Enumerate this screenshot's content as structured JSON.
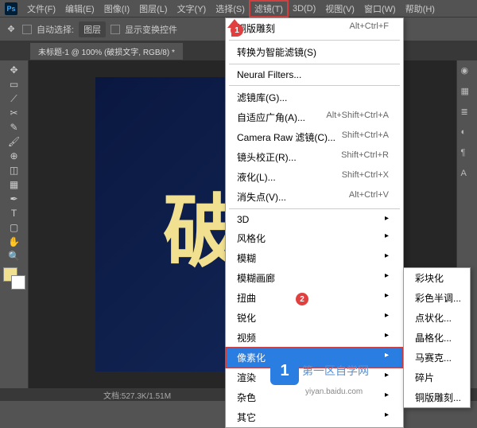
{
  "menubar": {
    "items": [
      "文件(F)",
      "编辑(E)",
      "图像(I)",
      "图层(L)",
      "文字(Y)",
      "选择(S)",
      "滤镜(T)",
      "3D(D)",
      "视图(V)",
      "窗口(W)",
      "帮助(H)"
    ],
    "active_index": 6
  },
  "optionsbar": {
    "auto_select": "自动选择:",
    "layer_select": "图层",
    "show_transform": "显示变换控件"
  },
  "doctab": {
    "title": "未标题-1 @ 100% (破损文字, RGB/8) *"
  },
  "canvas": {
    "text": "破损",
    "bg_color1": "#0a1840",
    "bg_color2": "#14285a",
    "text_color": "#f0e090"
  },
  "statusbar": {
    "text": "文档:527.3K/1.51M"
  },
  "dropdown_main": {
    "top": [
      {
        "label": "铜版雕刻",
        "shortcut": "Alt+Ctrl+F"
      }
    ],
    "smart": {
      "label": "转换为智能滤镜(S)"
    },
    "neural": {
      "label": "Neural Filters..."
    },
    "group1": [
      {
        "label": "滤镜库(G)...",
        "shortcut": ""
      },
      {
        "label": "自适应广角(A)...",
        "shortcut": "Alt+Shift+Ctrl+A"
      },
      {
        "label": "Camera Raw 滤镜(C)...",
        "shortcut": "Shift+Ctrl+A"
      },
      {
        "label": "镜头校正(R)...",
        "shortcut": "Shift+Ctrl+R"
      },
      {
        "label": "液化(L)...",
        "shortcut": "Shift+Ctrl+X"
      },
      {
        "label": "消失点(V)...",
        "shortcut": "Alt+Ctrl+V"
      }
    ],
    "group2": [
      {
        "label": "3D",
        "sub": true
      },
      {
        "label": "风格化",
        "sub": true
      },
      {
        "label": "模糊",
        "sub": true
      },
      {
        "label": "模糊画廊",
        "sub": true
      },
      {
        "label": "扭曲",
        "sub": true
      },
      {
        "label": "锐化",
        "sub": true
      },
      {
        "label": "视频",
        "sub": true
      },
      {
        "label": "像素化",
        "sub": true,
        "hover": true
      },
      {
        "label": "渲染",
        "sub": true
      },
      {
        "label": "杂色",
        "sub": true
      },
      {
        "label": "其它",
        "sub": true
      }
    ]
  },
  "dropdown_sub": {
    "items": [
      "彩块化",
      "彩色半调...",
      "点状化...",
      "晶格化...",
      "马赛克...",
      "碎片",
      "铜版雕刻..."
    ]
  },
  "markers": {
    "one": "1",
    "two": "2"
  },
  "swatches": {
    "fg": "#f0e090",
    "bg": "#ffffff"
  },
  "watermark": {
    "title": "第一区自学网",
    "sub": "yiyan.baidu.com"
  }
}
